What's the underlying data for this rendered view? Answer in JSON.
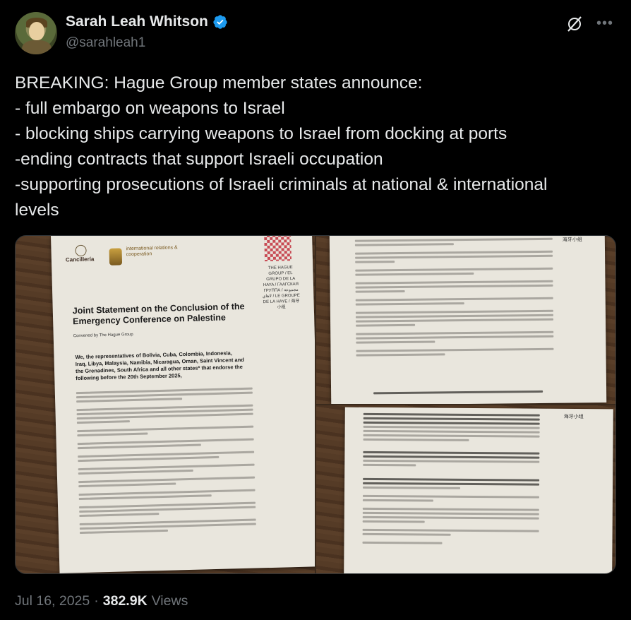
{
  "author": {
    "display_name": "Sarah Leah Whitson",
    "handle": "@sarahleah1",
    "verified": true,
    "verified_color": "#1d9bf0"
  },
  "tweet": {
    "lines": [
      "BREAKING: Hague Group member states announce:",
      "- full embargo on weapons to Israel",
      "- blocking ships carrying weapons to Israel from docking at ports",
      "-ending contracts that support Israeli occupation",
      "-supporting prosecutions of Israeli criminals at national & international",
      "levels"
    ]
  },
  "media": {
    "photo1": {
      "logo_left": "Cancillería",
      "logo_right": "international relations & cooperation",
      "hague_names": "THE HAGUE GROUP / EL GRUPO DE LA HAYA / ГААГСКАЯ ГРУППА / مجموعة لاهاي / LE GROUPE DE LA HAYE / 海牙小组",
      "title": "Joint Statement on the Conclusion of the Emergency Conference on Palestine",
      "convened": "Convened by The Hague Group",
      "bold_intro": "We, the representatives of Bolivia, Cuba, Colombia, Indonesia, Iraq, Libya, Malaysia, Namibia, Nicaragua, Oman, Saint Vincent and the Grenadines, South Africa and all other states* that endorse the following before the 20th September 2025,"
    },
    "photo2": {
      "corner_label": "海牙小组"
    },
    "photo3": {
      "corner_label": "海牙小组"
    }
  },
  "meta": {
    "date": "Jul 16, 2025",
    "separator": "·",
    "views_count": "382.9K",
    "views_label": "Views"
  },
  "colors": {
    "background": "#000000",
    "text": "#e7e9ea",
    "muted": "#71767b"
  },
  "icons": [
    "verified-badge-icon",
    "grok-icon",
    "more-icon"
  ]
}
